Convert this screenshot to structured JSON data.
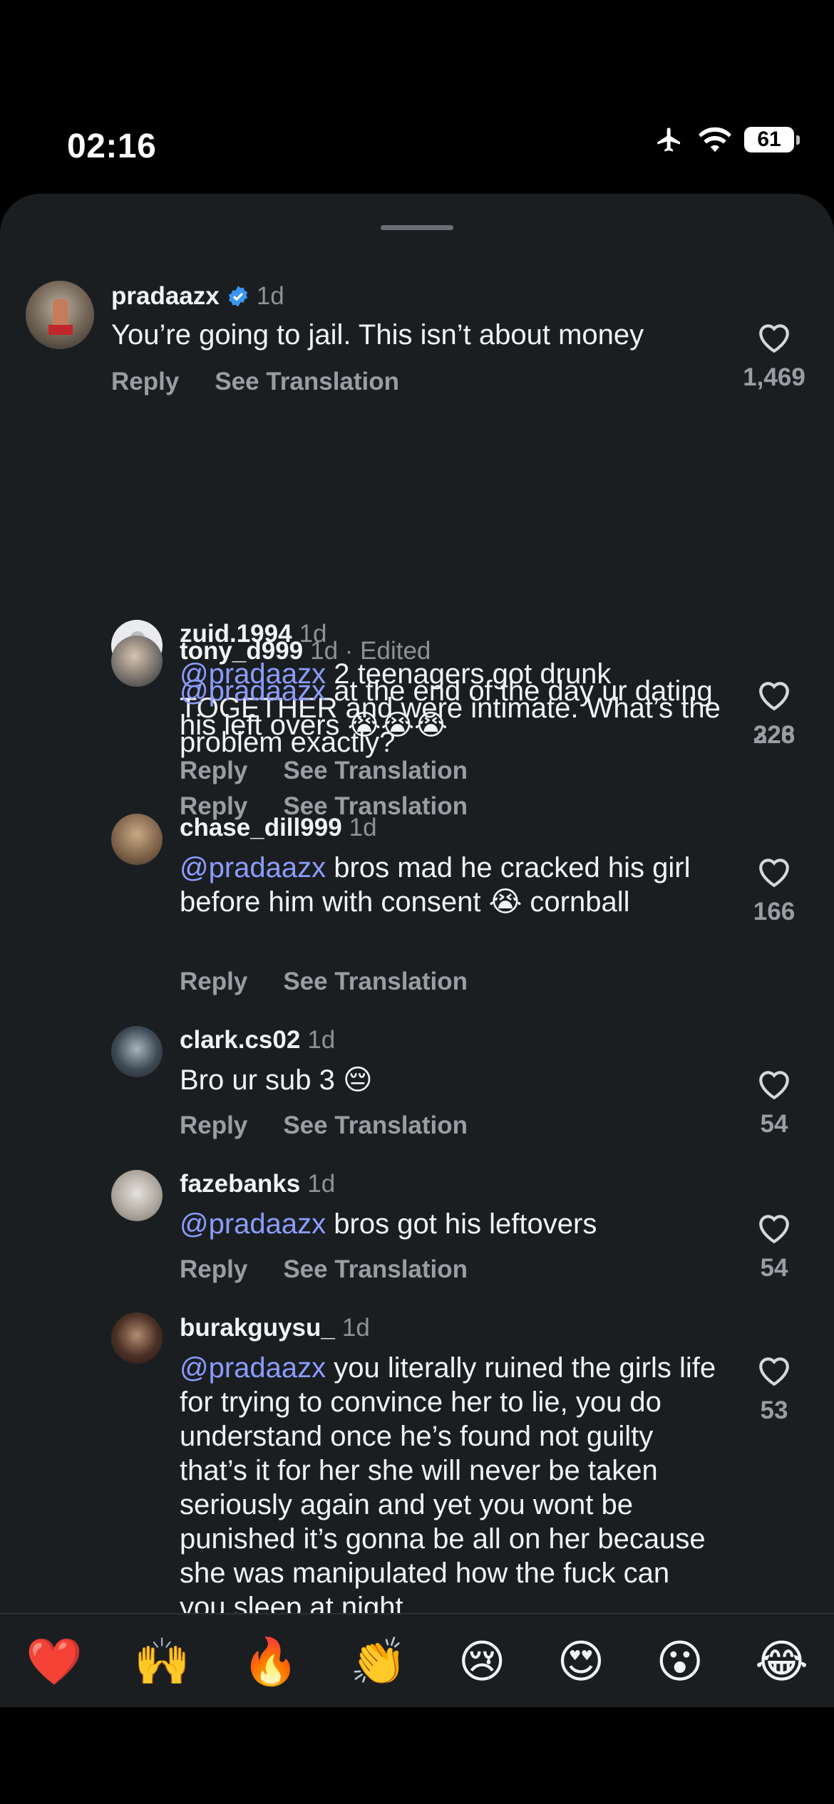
{
  "status_bar": {
    "time": "02:16",
    "battery": "61"
  },
  "comments": [
    {
      "username": "pradaazx",
      "time": "1d",
      "verified": true,
      "text": "You’re going to jail. This isn’t about money",
      "reply": "Reply",
      "translate": "See Translation",
      "likes": "1,469"
    },
    {
      "username": "zuid.1994",
      "time": "1d",
      "mention": "@pradaazx",
      "text": " 2 teenagers got drunk TOGETHER and were intimate. What’s the problem exactly?",
      "reply": "Reply",
      "translate": "See Translation",
      "likes": "228"
    },
    {
      "username": "tony_d999",
      "time": "1d · Edited",
      "mention": "@pradaazx",
      "text": " at the end of the day ur dating his left overs ",
      "emoji": "😭😭😭",
      "reply": "Reply",
      "translate": "See Translation",
      "likes": "326"
    },
    {
      "username": "chase_dill999",
      "time": "1d",
      "mention": "@pradaazx",
      "text": " bros mad he cracked his girl before him with consent ",
      "emoji": "😭",
      "text2": " cornball",
      "reply": "Reply",
      "translate": "See Translation",
      "likes": "166"
    },
    {
      "username": "clark.cs02",
      "time": "1d",
      "text": "Bro ur sub 3 ",
      "emoji": "😔",
      "reply": "Reply",
      "translate": "See Translation",
      "likes": "54"
    },
    {
      "username": "fazebanks",
      "time": "1d",
      "mention": "@pradaazx",
      "text": " bros got his leftovers",
      "reply": "Reply",
      "translate": "See Translation",
      "likes": "54"
    },
    {
      "username": "burakguysu_",
      "time": "1d",
      "mention": "@pradaazx",
      "text": " you literally ruined the girls life for trying to convince her to lie, you do understand once he’s found not guilty that’s it for her she will never be taken seriously again and yet you wont be punished it’s gonna be all on her because she was manipulated how the fuck can you sleep at night",
      "likes": "53"
    }
  ],
  "reactions": [
    "❤️",
    "🙌",
    "🔥",
    "👏",
    "😢",
    "😍",
    "😮",
    "😂"
  ],
  "colors": {
    "background": "#1b1e21",
    "mention": "#8c9cff",
    "secondary_text": "#9a9ea3",
    "verified": "#3897f0"
  }
}
